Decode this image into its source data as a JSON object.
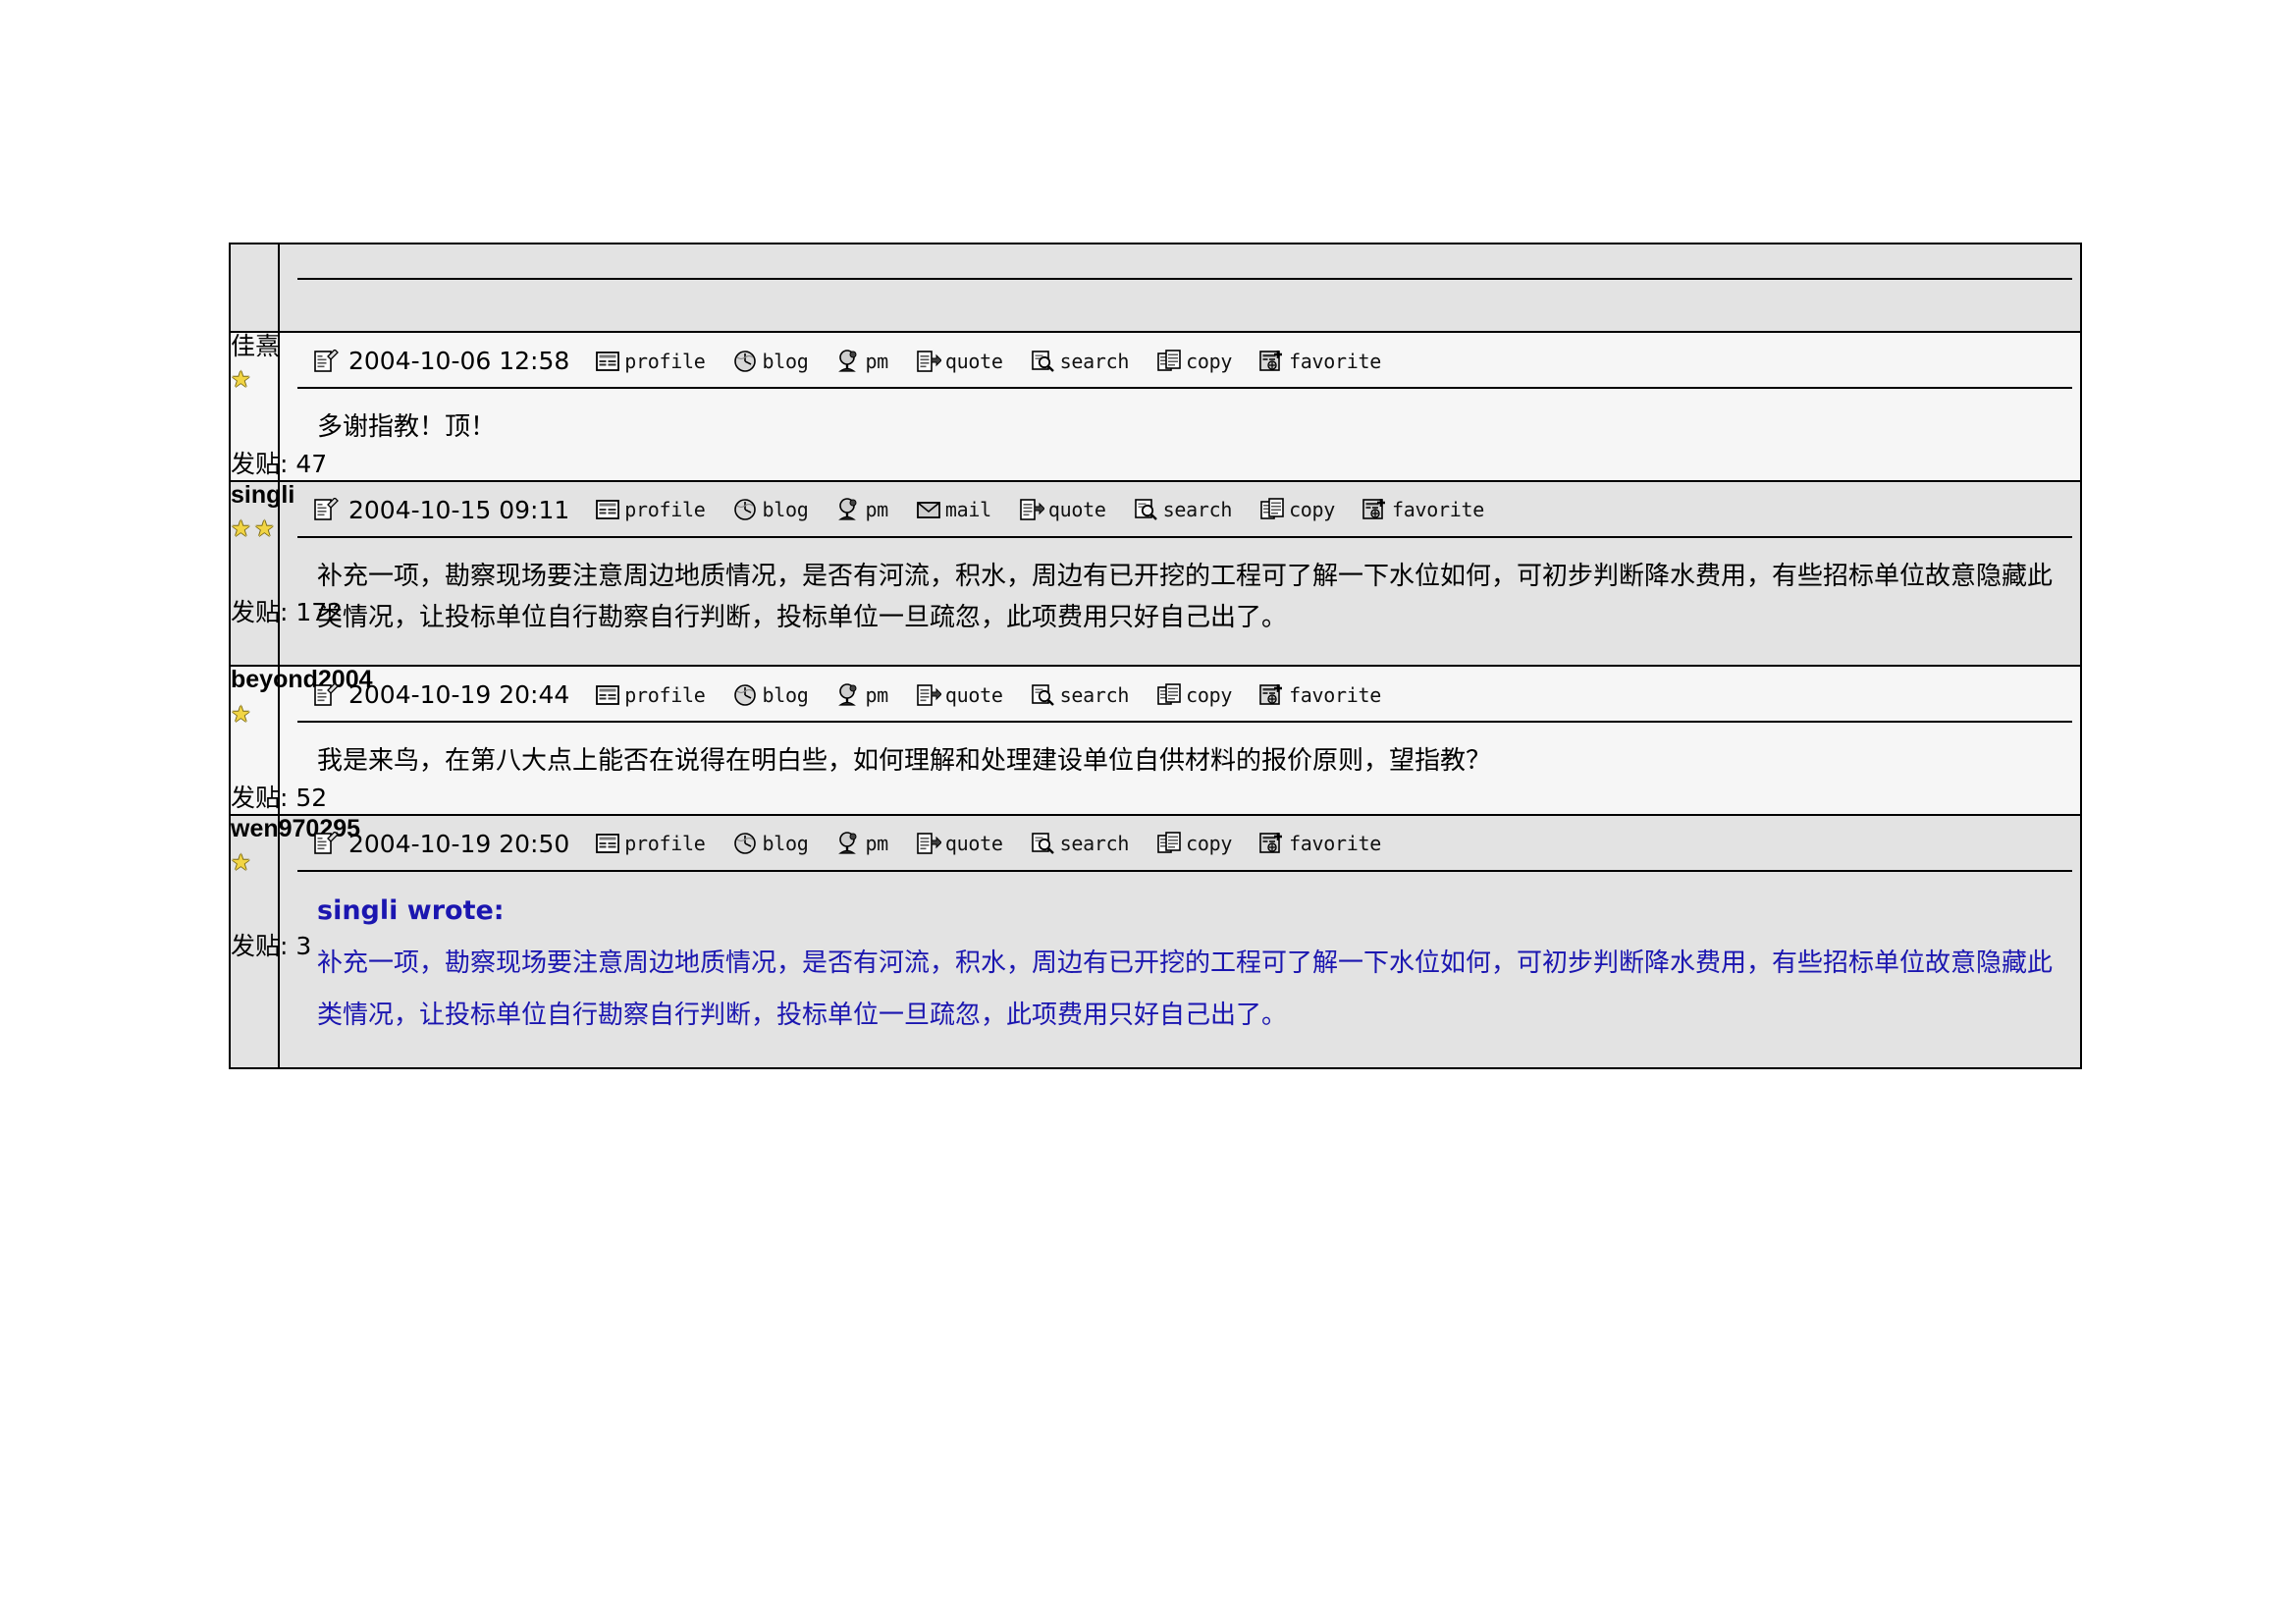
{
  "forum": {
    "top_row": {
      "rule": true
    },
    "labels": {
      "post_count_prefix": "发贴:"
    },
    "tools": {
      "profile": "profile",
      "blog": "blog",
      "pm": "pm",
      "mail": "mail",
      "quote": "quote",
      "search": "search",
      "copy": "copy",
      "favorite": "favorite"
    },
    "icon_names": {
      "post": "post-note-icon",
      "profile": "profile-card-icon",
      "blog": "blog-globe-icon",
      "pm": "pm-lamp-icon",
      "mail": "mail-envelope-icon",
      "quote": "quote-arrow-icon",
      "search": "search-magnifier-icon",
      "copy": "copy-pages-icon",
      "favorite": "favorite-add-icon",
      "star": "rank-star-icon"
    },
    "colors": {
      "row_grey": "#e3e3e3",
      "row_light": "#f6f6f6",
      "quote_blue": "#1b16b0",
      "star_yellow": "#f2d544",
      "border": "#000000"
    },
    "posts": [
      {
        "author": "佳熹",
        "author_style": "cjk",
        "stars": 1,
        "post_count": "47",
        "timestamp": "2004-10-06 12:58",
        "tools": [
          "profile",
          "blog",
          "pm",
          "quote",
          "search",
          "copy",
          "favorite"
        ],
        "row_bg": "light",
        "author_wide": false,
        "content_type": "text",
        "text": "多谢指教！顶！",
        "quote_author": "",
        "quote_text": ""
      },
      {
        "author": "singli",
        "author_style": "bold",
        "stars": 2,
        "post_count": "172",
        "timestamp": "2004-10-15 09:11",
        "tools": [
          "profile",
          "blog",
          "pm",
          "mail",
          "quote",
          "search",
          "copy",
          "favorite"
        ],
        "row_bg": "grey",
        "author_wide": false,
        "content_type": "text",
        "text": "补充一项，勘察现场要注意周边地质情况，是否有河流，积水，周边有已开挖的工程可了解一下水位如何，可初步判断降水费用，有些招标单位故意隐藏此类情况，让投标单位自行勘察自行判断，投标单位一旦疏忽，此项费用只好自己出了。",
        "quote_author": "",
        "quote_text": ""
      },
      {
        "author": "beyond2004",
        "author_style": "bold",
        "stars": 1,
        "post_count": "52",
        "timestamp": "2004-10-19 20:44",
        "tools": [
          "profile",
          "blog",
          "pm",
          "quote",
          "search",
          "copy",
          "favorite"
        ],
        "row_bg": "light",
        "author_wide": true,
        "content_type": "text",
        "text": "我是来鸟，在第八大点上能否在说得在明白些，如何理解和处理建设单位自供材料的报价原则，望指教？",
        "quote_author": "",
        "quote_text": ""
      },
      {
        "author": "wen970295",
        "author_style": "bold",
        "stars": 1,
        "post_count": "3",
        "timestamp": "2004-10-19 20:50",
        "tools": [
          "profile",
          "blog",
          "pm",
          "quote",
          "search",
          "copy",
          "favorite"
        ],
        "row_bg": "grey",
        "author_wide": false,
        "content_type": "quote",
        "text": "",
        "quote_author": "singli wrote:",
        "quote_text": "补充一项，勘察现场要注意周边地质情况，是否有河流，积水，周边有已开挖的工程可了解一下水位如何，可初步判断降水费用，有些招标单位故意隐藏此类情况，让投标单位自行勘察自行判断，投标单位一旦疏忽，此项费用只好自己出了。"
      }
    ]
  }
}
